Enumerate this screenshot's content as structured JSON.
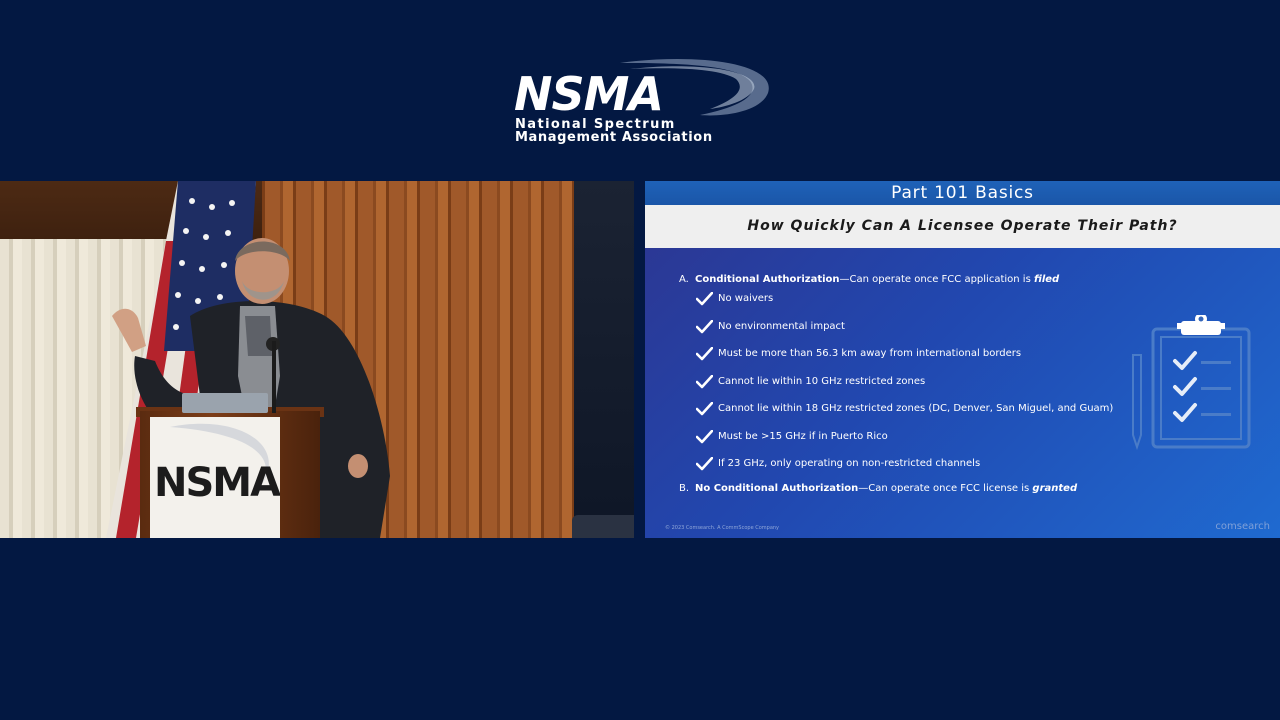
{
  "logo": {
    "wordmark": "NSMA",
    "line1": "National Spectrum",
    "line2": "Management Association"
  },
  "camera": {
    "podium_sign": "NSMA"
  },
  "slide": {
    "header": "Part 101 Basics",
    "question": "How Quickly Can A Licensee Operate Their Path?",
    "item_a": {
      "letter": "A.",
      "title": "Conditional Authorization",
      "dash": "—",
      "text": "Can operate once FCC application is ",
      "emphasis": "filed"
    },
    "checks": [
      "No waivers",
      "No environmental impact",
      "Must be more than 56.3 km away from international borders",
      "Cannot lie within 10 GHz restricted zones",
      "Cannot lie within 18 GHz restricted zones (DC, Denver, San Miguel, and Guam)",
      "Must be >15 GHz if in Puerto Rico",
      "If 23 GHz, only operating on non-restricted channels"
    ],
    "item_b": {
      "letter": "B.",
      "title": "No Conditional Authorization",
      "dash": "—",
      "text": "Can operate once FCC license is ",
      "emphasis": "granted"
    },
    "footer_left": "© 2023 Comsearch. A CommScope Company",
    "footer_right": "comsearch"
  },
  "colors": {
    "background": "#031842",
    "slide_gradient_start": "#2d3590",
    "slide_gradient_end": "#1f6ad0",
    "header_bar": "#1f62b8",
    "subbar": "#efefef",
    "check": "#ffffff"
  }
}
